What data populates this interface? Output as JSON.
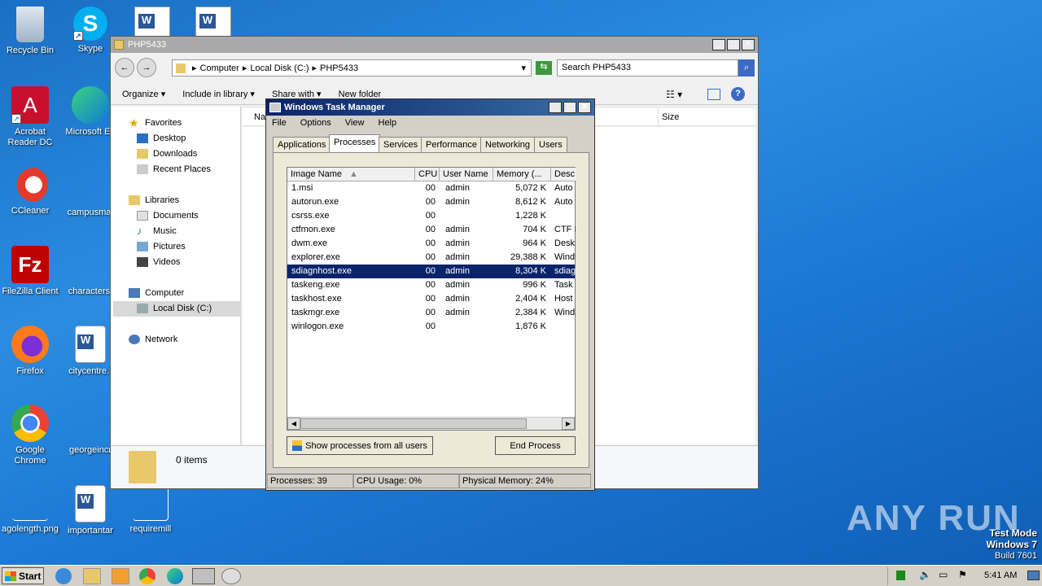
{
  "desktop": {
    "icons": [
      {
        "label": "Recycle Bin",
        "icon": "recycle-bin-icon"
      },
      {
        "label": "Skype",
        "icon": "skype-icon"
      },
      {
        "label": "Acrobat Reader DC",
        "icon": "acrobat-icon"
      },
      {
        "label": "Microsoft Ed",
        "icon": "edge-icon"
      },
      {
        "label": "CCleaner",
        "icon": "ccleaner-icon"
      },
      {
        "label": "campusmat",
        "icon": "word-doc-icon"
      },
      {
        "label": "FileZilla Client",
        "icon": "filezilla-icon"
      },
      {
        "label": "characterst",
        "icon": "word-doc-icon"
      },
      {
        "label": "Firefox",
        "icon": "firefox-icon"
      },
      {
        "label": "citycentre.r",
        "icon": "word-doc-icon"
      },
      {
        "label": "Google Chrome",
        "icon": "chrome-icon"
      },
      {
        "label": "georgeincr",
        "icon": "word-doc-icon"
      },
      {
        "label": "agolength.png",
        "icon": "image-file-icon"
      },
      {
        "label": "importantar",
        "icon": "word-doc-icon"
      },
      {
        "label": "requiremill",
        "icon": "word-doc-icon"
      }
    ],
    "watermark": {
      "brand": "ANY RUN",
      "line1": "Test Mode",
      "line2": "Windows 7",
      "line3": "Build 7601"
    }
  },
  "explorer": {
    "title": "PHP5433",
    "breadcrumb": [
      "Computer",
      "Local Disk (C:)",
      "PHP5433"
    ],
    "search_placeholder": "Search PHP5433",
    "toolbar": {
      "organize": "Organize",
      "include": "Include in library",
      "share": "Share with",
      "newfolder": "New folder"
    },
    "nav": {
      "favorites": "Favorites",
      "desktop": "Desktop",
      "downloads": "Downloads",
      "recent": "Recent Places",
      "libraries": "Libraries",
      "documents": "Documents",
      "music": "Music",
      "pictures": "Pictures",
      "videos": "Videos",
      "computer": "Computer",
      "localdisk": "Local Disk (C:)",
      "network": "Network"
    },
    "columns": {
      "name": "Na",
      "size": "Size"
    },
    "status": "0 items"
  },
  "taskmanager": {
    "title": "Windows Task Manager",
    "menu": [
      "File",
      "Options",
      "View",
      "Help"
    ],
    "tabs": [
      "Applications",
      "Processes",
      "Services",
      "Performance",
      "Networking",
      "Users"
    ],
    "columns": [
      "Image Name",
      "CPU",
      "User Name",
      "Memory (...",
      "Desc"
    ],
    "rows": [
      {
        "name": "1.msi",
        "cpu": "00",
        "user": "admin",
        "mem": "5,072 K",
        "desc": "Auto"
      },
      {
        "name": "autorun.exe",
        "cpu": "00",
        "user": "admin",
        "mem": "8,612 K",
        "desc": "Auto"
      },
      {
        "name": "csrss.exe",
        "cpu": "00",
        "user": "",
        "mem": "1,228 K",
        "desc": ""
      },
      {
        "name": "ctfmon.exe",
        "cpu": "00",
        "user": "admin",
        "mem": "704 K",
        "desc": "CTF I"
      },
      {
        "name": "dwm.exe",
        "cpu": "00",
        "user": "admin",
        "mem": "964 K",
        "desc": "Desk"
      },
      {
        "name": "explorer.exe",
        "cpu": "00",
        "user": "admin",
        "mem": "29,388 K",
        "desc": "Wind"
      },
      {
        "name": "sdiagnhost.exe",
        "cpu": "00",
        "user": "admin",
        "mem": "8,304 K",
        "desc": "sdiag"
      },
      {
        "name": "taskeng.exe",
        "cpu": "00",
        "user": "admin",
        "mem": "996 K",
        "desc": "Task"
      },
      {
        "name": "taskhost.exe",
        "cpu": "00",
        "user": "admin",
        "mem": "2,404 K",
        "desc": "Host"
      },
      {
        "name": "taskmgr.exe",
        "cpu": "00",
        "user": "admin",
        "mem": "2,384 K",
        "desc": "Wind"
      },
      {
        "name": "winlogon.exe",
        "cpu": "00",
        "user": "",
        "mem": "1,876 K",
        "desc": ""
      }
    ],
    "show_all_button": "Show processes from all users",
    "end_process_button": "End Process",
    "status": {
      "processes": "Processes: 39",
      "cpu": "CPU Usage: 0%",
      "memory": "Physical Memory: 24%"
    }
  },
  "taskbar": {
    "start": "Start",
    "clock": "5:41 AM"
  },
  "colors": {
    "selection": "#0a246a",
    "desktop": "#1c78d4"
  }
}
